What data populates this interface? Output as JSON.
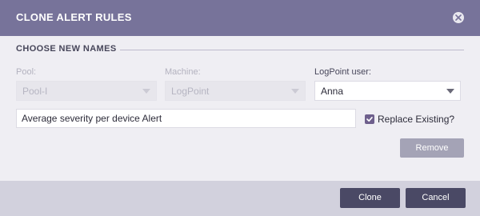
{
  "dialog": {
    "title": "CLONE ALERT RULES",
    "close_icon": "close-icon"
  },
  "section": {
    "title": "CHOOSE NEW NAMES"
  },
  "fields": {
    "pool": {
      "label": "Pool:",
      "value": "Pool-I",
      "disabled": true
    },
    "machine": {
      "label": "Machine:",
      "value": "LogPoint",
      "disabled": true
    },
    "user": {
      "label": "LogPoint user:",
      "value": "Anna",
      "disabled": false
    }
  },
  "alert_name": {
    "value": "Average severity per device Alert"
  },
  "replace_existing": {
    "label": "Replace Existing?",
    "checked": true
  },
  "buttons": {
    "remove": "Remove",
    "clone": "Clone",
    "cancel": "Cancel"
  },
  "colors": {
    "header": "#77739a",
    "primary_button": "#4a4965",
    "disabled_button": "#a4a3b6",
    "checkbox": "#6e5f8c"
  }
}
